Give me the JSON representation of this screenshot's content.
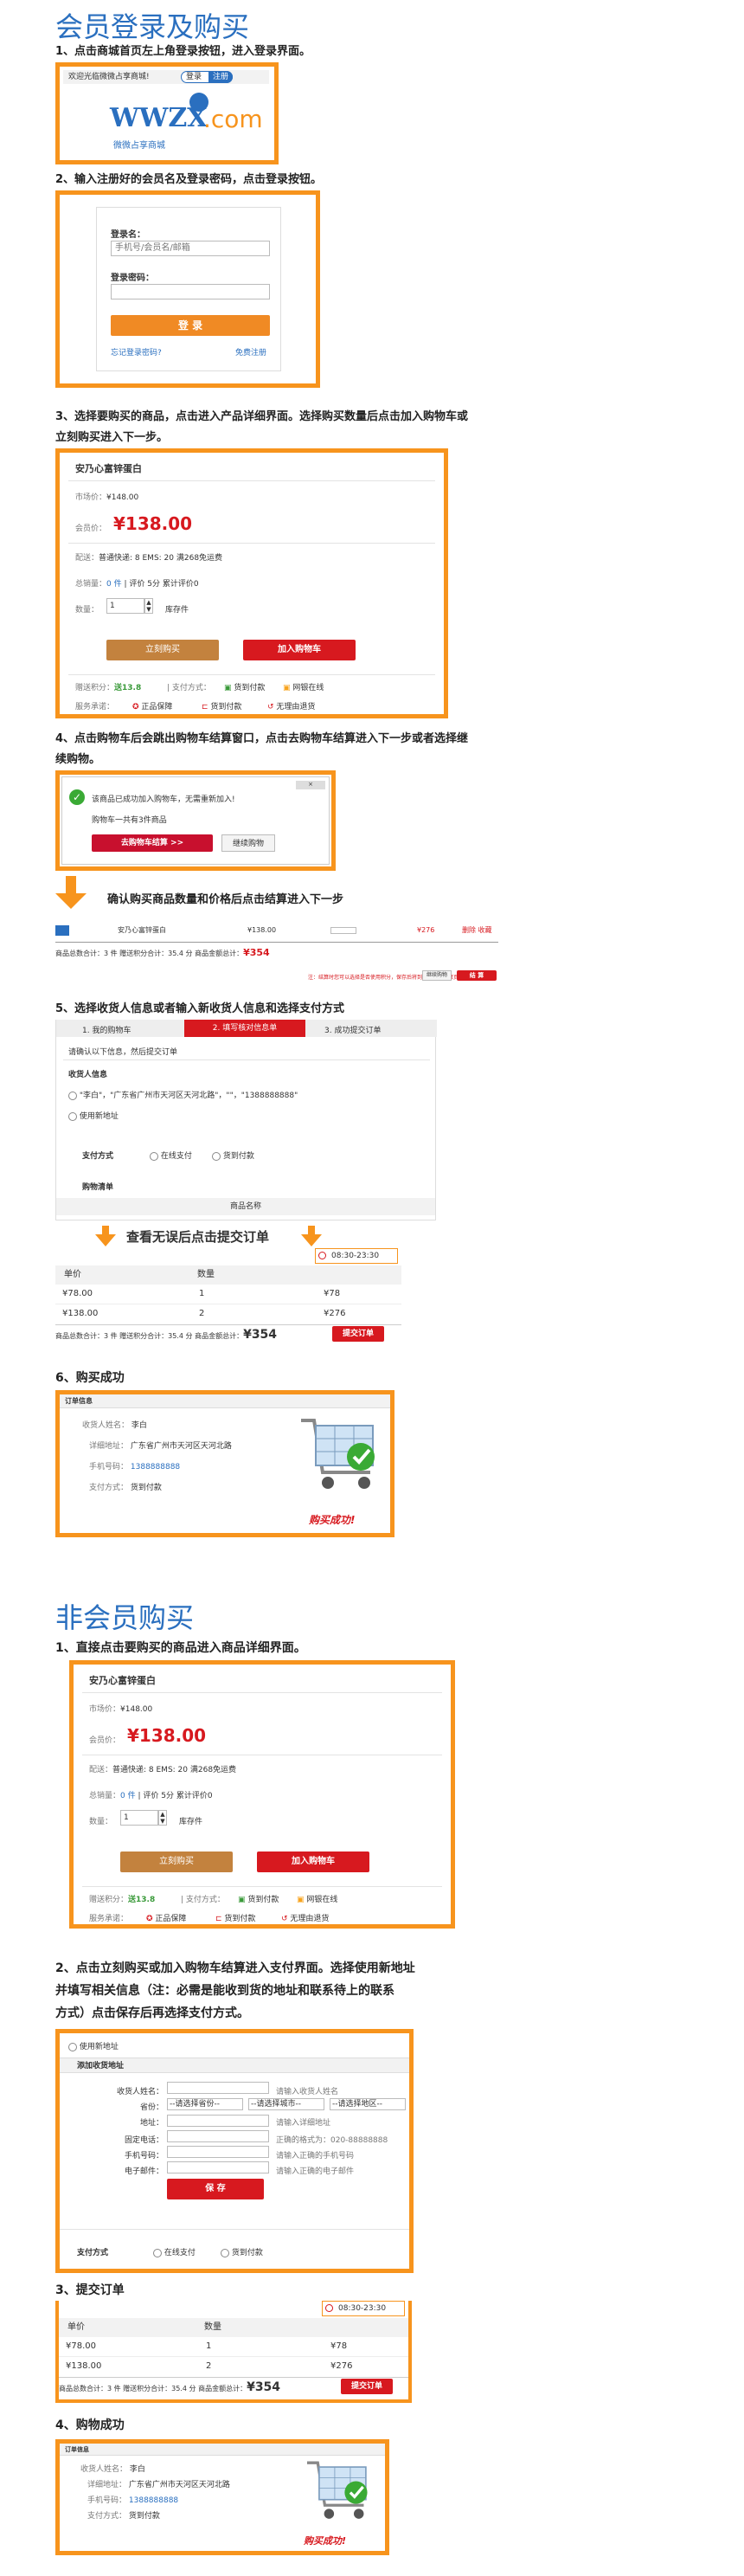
{
  "section1": {
    "title": "会员登录及购买"
  },
  "s1": {
    "step1": "1、点击商城首页左上角登录按钮，进入登录界面。",
    "welcome": "欢迎光临微微占享商城!",
    "login_tab": "登录",
    "register_tab": "注册",
    "logo_text": "WWZX",
    "logo_com": ".com",
    "logo_sub": "微微占享商城",
    "step2": "2、输入注册好的会员名及登录密码，点击登录按钮。",
    "login_name_label": "登录名：",
    "login_name_placeholder": "手机号/会员名/邮箱",
    "password_label": "登录密码：",
    "login_button": "登 录",
    "forgot": "忘记登录密码?",
    "free_register": "免费注册",
    "step3a": "3、选择要购买的商品，点击进入产品详细界面。选择购买数量后点击加入购物车或",
    "step3b": "立刻购买进入下一步。",
    "step4a": "4、点击购物车后会跳出购物车结算窗口，点击去购物车结算进入下一步或者选择继",
    "step4b": "续购物。",
    "popup_msg": "该商品已成功加入购物车，无需重新加入!",
    "popup_sub": "购物车一共有3件商品",
    "go_cart": "去购物车结算 >>",
    "continue": "继续购物",
    "arrow_text": "确认购买商品数量和价格后点击结算进入下一步",
    "cart_item_name": "安乃心富锌蛋白",
    "cart_item_price": "¥138.00",
    "cart_item_sub": "¥276",
    "cart_item_ops": "删除 收藏",
    "cart_summary": "商品总数合计：3 件   赠送积分合计：35.4 分  商品金额总计：",
    "cart_total": "¥354",
    "cart_note": "注：结算时您可以选择是否使用积分，保存后将到下一步的结算页面",
    "cart_continue": "继续购物",
    "cart_checkout": "结 算",
    "step5": "5、选择收货人信息或者输入新收货人信息和选择支付方式",
    "flow1": "1. 我的购物车",
    "flow2": "2. 填写核对信息单",
    "flow3": "3. 成功提交订单",
    "confirm_hint": "请确认以下信息，然后提交订单",
    "receiver_title": "收货人信息",
    "receiver_addr": "\"李白\"，\"广东省广州市天河区天河北路\"，\"\"，\"1388888888\"",
    "use_new_addr": "使用新地址",
    "pay_label": "支付方式",
    "pay_online": "在线支付",
    "pay_cod": "货到付款",
    "product_list": "购物清单",
    "product_name_col": "商品名称",
    "review_text": "查看无误后点击提交订单",
    "time_range": "08:30-23:30",
    "col_price": "单价",
    "col_qty": "数量",
    "rows": [
      {
        "price": "¥78.00",
        "qty": "1",
        "sub": "¥78"
      },
      {
        "price": "¥138.00",
        "qty": "2",
        "sub": "¥276"
      }
    ],
    "order_summary": "商品总数合计：3 件   赠送积分合计：35.4 分   商品金额总计：",
    "order_total": "¥354",
    "submit": "提交订单",
    "step6": "6、购买成功",
    "order_info": "订单信息",
    "oi_name_label": "收货人姓名：",
    "oi_name": "李白",
    "oi_addr_label": "详细地址：",
    "oi_addr": "广东省广州市天河区天河北路",
    "oi_phone_label": "手机号码：",
    "oi_phone": "1388888888",
    "oi_pay_label": "支付方式：",
    "oi_pay": "货到付款",
    "success": "购买成功!"
  },
  "product": {
    "name": "安乃心富锌蛋白",
    "market_label": "市场价：",
    "market_price": "¥148.00",
    "member_label": "会员价：",
    "member_price": "¥138.00",
    "ship_label": "配送：",
    "ship_info": "普通快递: 8  EMS: 20   满268免运费",
    "stock_label": "总销量：",
    "stock_val": "0 件",
    "rating": "| 评价 5分  累计评价0",
    "qty_label": "数量：",
    "qty_val": "1",
    "stock_note": "库存件",
    "buy_now": "立刻购买",
    "add_cart": "加入购物车",
    "points_label": "赠送积分：",
    "points_val": "送13.8",
    "pay_label": "| 支付方式：",
    "pay1": "货到付款",
    "pay2": "网银在线",
    "promise_label": "服务承诺：",
    "promise1": "正品保障",
    "promise2": "货到付款",
    "promise3": "无理由退货"
  },
  "section2": {
    "title": "非会员购买"
  },
  "s2": {
    "step1": "1、直接点击要购买的商品进入商品详细界面。",
    "step2a": "2、点击立刻购买或加入购物车结算进入支付界面。选择使用新地址",
    "step2b": "并填写相关信息（注：必需是能收到货的地址和联系待上的联系",
    "step2c": "方式）点击保存后再选择支付方式。",
    "use_new": "使用新地址",
    "add_addr": "添加收货地址",
    "f_name": "收货人姓名：",
    "f_name_tip": "请输入收货人姓名",
    "f_region": "省份：",
    "sel1": "--请选择省份--",
    "sel2": "--请选择城市--",
    "sel3": "--请选择地区--",
    "f_addr": "地址：",
    "f_addr_tip": "请输入详细地址",
    "f_tel": "固定电话：",
    "f_tel_tip": "正确的格式为：020-88888888",
    "f_mobile": "手机号码：",
    "f_mobile_tip": "请输入正确的手机号码",
    "f_email": "电子邮件：",
    "f_email_tip": "请输入正确的电子邮件",
    "save": "保 存",
    "pay_label": "支付方式",
    "pay_online": "在线支付",
    "pay_cod": "货到付款",
    "step3": "3、提交订单",
    "step4": "4、购物成功"
  }
}
